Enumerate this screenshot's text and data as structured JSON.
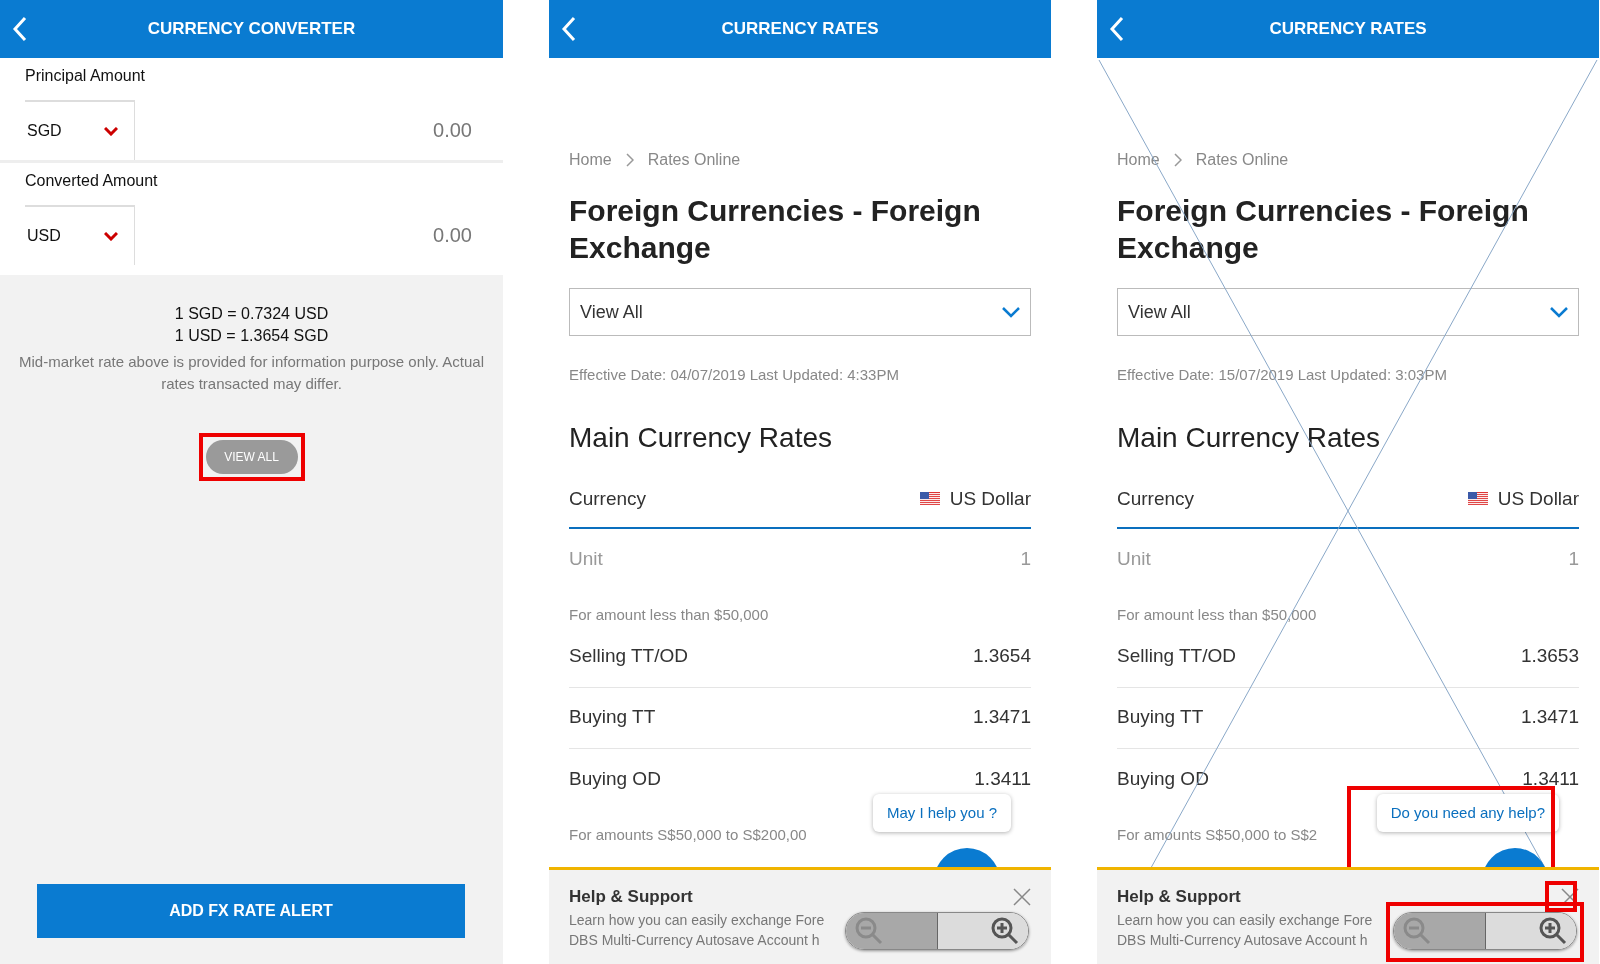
{
  "converter": {
    "title": "CURRENCY CONVERTER",
    "fields": [
      {
        "label": "Principal Amount",
        "currency": "SGD",
        "amount": "0.00"
      },
      {
        "label": "Converted Amount",
        "currency": "USD",
        "amount": "0.00"
      }
    ],
    "rates": [
      "1 SGD = 0.7324 USD",
      "1 USD = 1.3654 SGD"
    ],
    "disclaimer": "Mid-market rate above is provided for information purpose only. Actual rates transacted may differ.",
    "view_all_button": {
      "label": "VIEW ALL",
      "highlighted": true
    },
    "alert_button": "ADD FX RATE ALERT"
  },
  "rate_screens": [
    {
      "title": "CURRENCY RATES",
      "overlay_guides": false,
      "breadcrumb": [
        "Home",
        "Rates Online"
      ],
      "heading": "Foreign Currencies - Foreign Exchange",
      "dropdown": "View All",
      "effective": "Effective Date: 04/07/2019 Last Updated: 4:33PM",
      "section_title": "Main Currency Rates",
      "table_header": {
        "label": "Currency",
        "currency": "US Dollar"
      },
      "rows": [
        {
          "kind": "unit",
          "label": "Unit",
          "value": "1"
        },
        {
          "kind": "note",
          "label": "For amount less than $50,000"
        },
        {
          "kind": "rate",
          "label": "Selling TT/OD",
          "value": "1.3654"
        },
        {
          "kind": "rate",
          "label": "Buying TT",
          "value": "1.3471"
        },
        {
          "kind": "rate",
          "label": "Buying OD",
          "value": "1.3411"
        },
        {
          "kind": "note",
          "label": "For amounts S$50,000 to S$200,00"
        }
      ],
      "help_bubble": {
        "text": "May I help you ?",
        "highlighted": false
      },
      "help_panel": {
        "title": "Help & Support",
        "lines": [
          "Learn how you can easily exchange Fore",
          "DBS Multi-Currency Autosave Account h"
        ],
        "close_highlighted": false
      },
      "zoom_control": {
        "highlighted": false
      }
    },
    {
      "title": "CURRENCY RATES",
      "overlay_guides": true,
      "breadcrumb": [
        "Home",
        "Rates Online"
      ],
      "heading": "Foreign Currencies - Foreign Exchange",
      "dropdown": "View All",
      "effective": "Effective Date: 15/07/2019 Last Updated: 3:03PM",
      "section_title": "Main Currency Rates",
      "table_header": {
        "label": "Currency",
        "currency": "US Dollar"
      },
      "rows": [
        {
          "kind": "unit",
          "label": "Unit",
          "value": "1"
        },
        {
          "kind": "note",
          "label": "For amount less than $50,000"
        },
        {
          "kind": "rate",
          "label": "Selling TT/OD",
          "value": "1.3653"
        },
        {
          "kind": "rate",
          "label": "Buying TT",
          "value": "1.3471"
        },
        {
          "kind": "rate",
          "label": "Buying OD",
          "value": "1.3411"
        },
        {
          "kind": "note",
          "label": "For amounts S$50,000 to S$2"
        }
      ],
      "help_bubble": {
        "text": "Do you need any help?",
        "highlighted": true
      },
      "help_panel": {
        "title": "Help & Support",
        "lines": [
          "Learn how you can easily exchange Fore",
          "DBS Multi-Currency Autosave Account h"
        ],
        "close_highlighted": true
      },
      "zoom_control": {
        "highlighted": true
      }
    }
  ]
}
